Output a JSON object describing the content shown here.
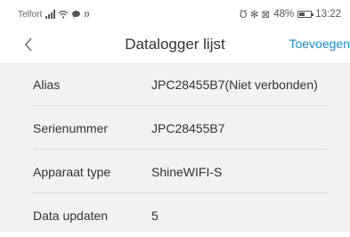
{
  "status_bar": {
    "carrier": "Telfort",
    "status_glyphs": "Ʊ ✻ ⊠",
    "battery_percent": "48%",
    "time": "13:22"
  },
  "nav": {
    "title": "Datalogger lijst",
    "add_label": "Toevoegen",
    "accent_color": "#1a8ad0"
  },
  "details": {
    "rows": [
      {
        "label": "Alias",
        "value": "JPC28455B7(Niet verbonden)"
      },
      {
        "label": "Serienummer",
        "value": "JPC28455B7"
      },
      {
        "label": "Apparaat type",
        "value": "ShineWIFI-S"
      },
      {
        "label": "Data updaten",
        "value": "5"
      }
    ]
  }
}
